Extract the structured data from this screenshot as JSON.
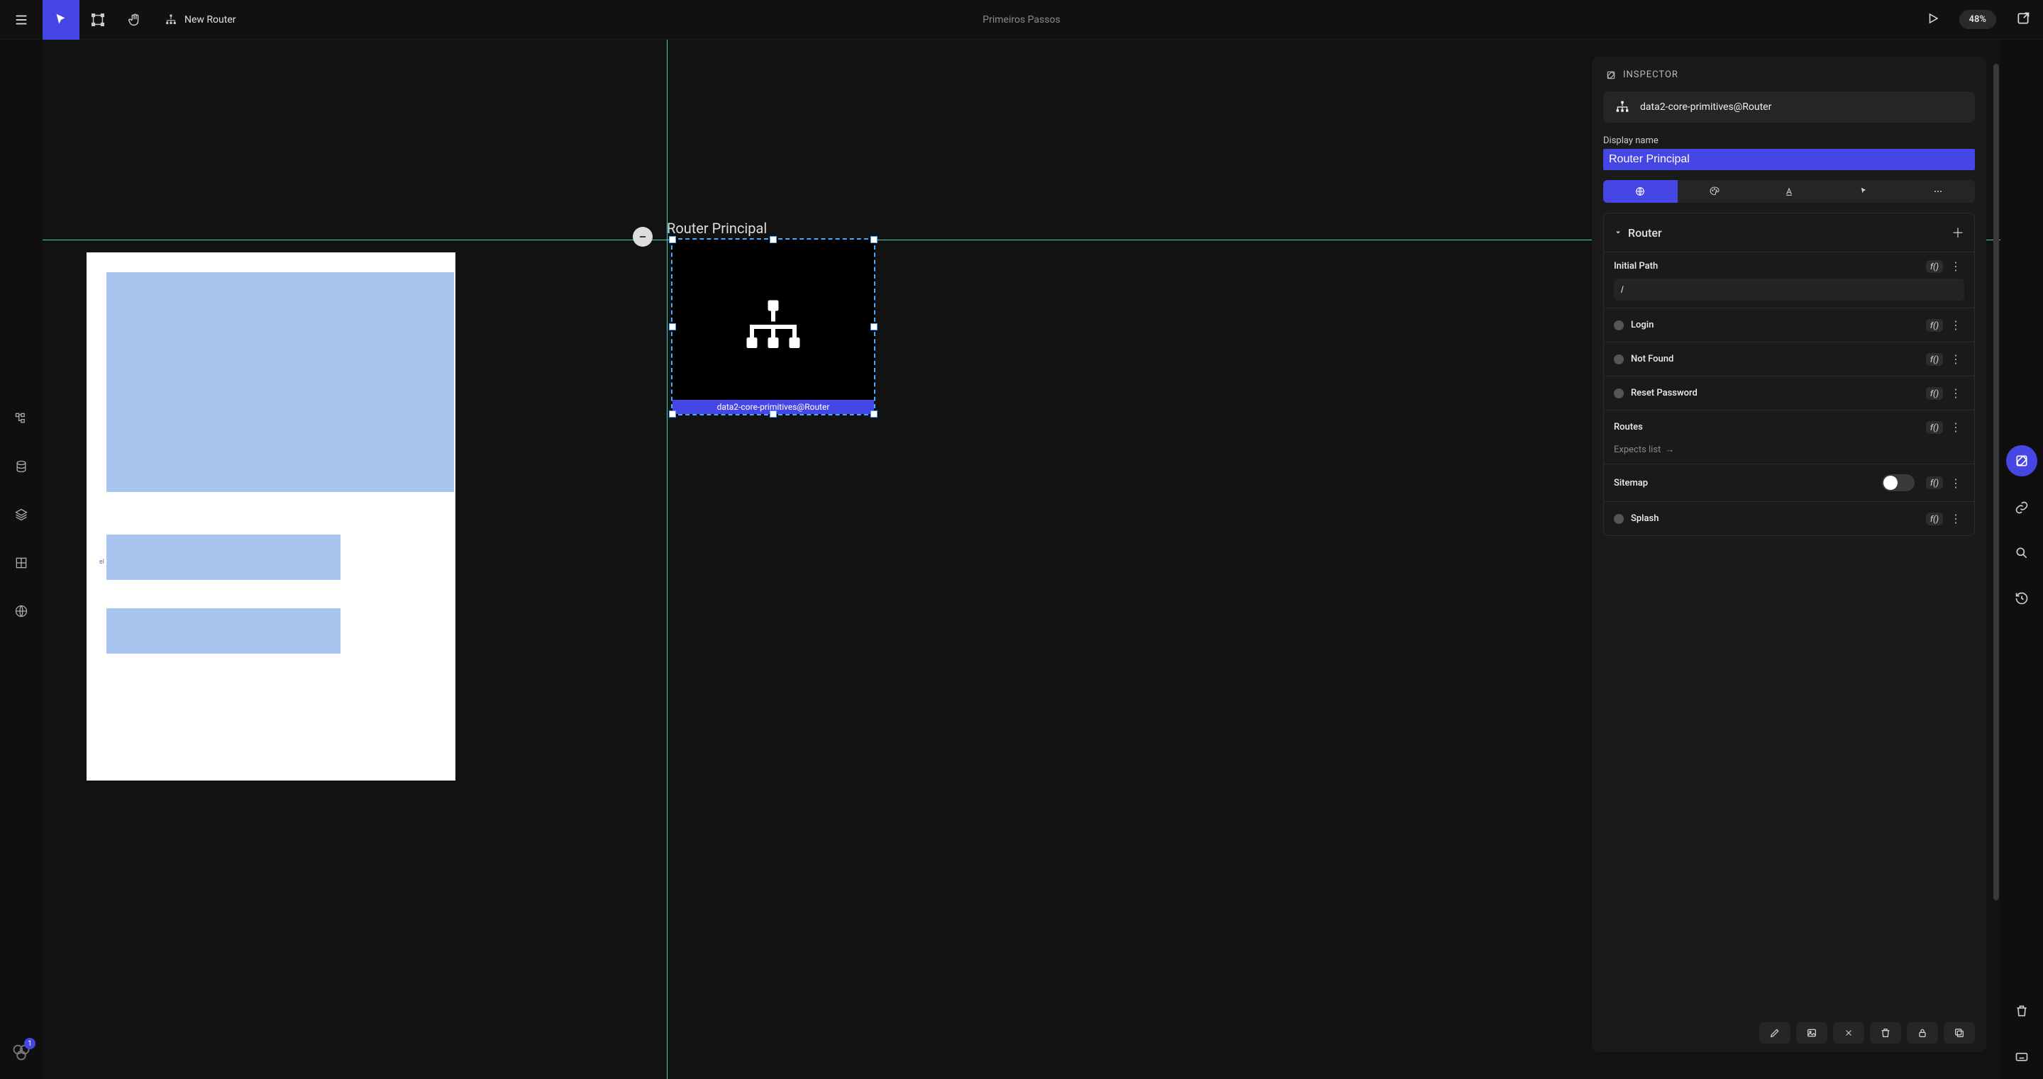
{
  "topbar": {
    "new_router_label": "New Router",
    "title": "Primeiros Passos",
    "zoom": "48%"
  },
  "canvas": {
    "router_title": "Router Principal",
    "router_caption": "data2-core-primitives@Router",
    "thumb_label": "el"
  },
  "left_sidebar": {
    "badge_count": "1"
  },
  "inspector": {
    "header": "INSPECTOR",
    "type_label": "data2-core-primitives@Router",
    "display_name_label": "Display name",
    "display_name_value": "Router Principal",
    "section_title": "Router",
    "initial_path_label": "Initial Path",
    "initial_path_value": "/",
    "fx_label": "f()",
    "props": {
      "login": "Login",
      "not_found": "Not Found",
      "reset_password": "Reset Password",
      "routes": "Routes",
      "routes_hint": "Expects list",
      "sitemap": "Sitemap",
      "splash": "Splash"
    }
  }
}
